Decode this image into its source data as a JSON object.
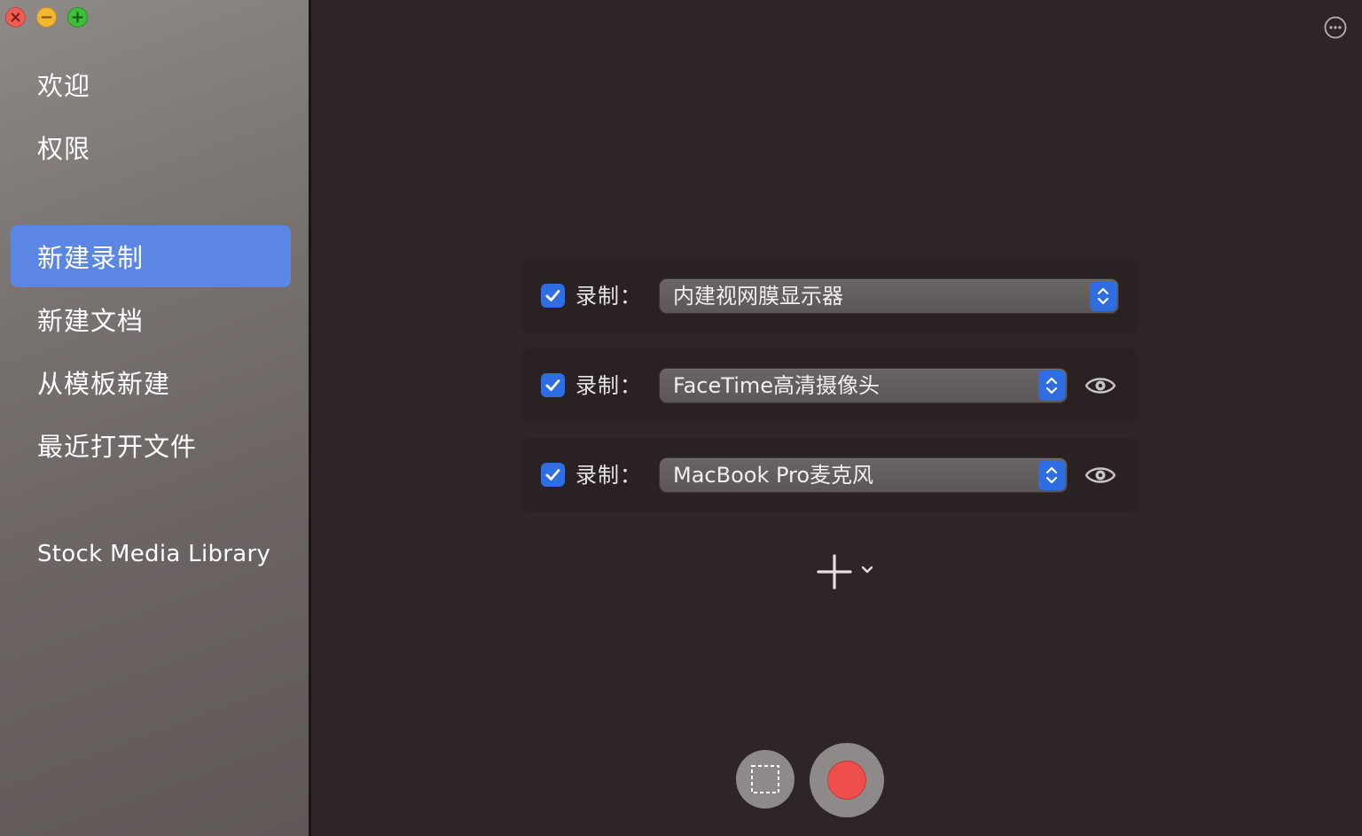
{
  "sidebar": {
    "items": [
      {
        "label": "欢迎",
        "selected": false
      },
      {
        "label": "权限",
        "selected": false
      },
      {
        "label": "新建录制",
        "selected": true
      },
      {
        "label": "新建文档",
        "selected": false
      },
      {
        "label": "从模板新建",
        "selected": false
      },
      {
        "label": "最近打开文件",
        "selected": false
      },
      {
        "label": "Stock Media Library",
        "selected": false
      }
    ]
  },
  "sources": [
    {
      "label": "录制：",
      "checked": true,
      "value": "内建视网膜显示器",
      "has_preview": false
    },
    {
      "label": "录制：",
      "checked": true,
      "value": "FaceTime高清摄像头",
      "has_preview": true
    },
    {
      "label": "录制：",
      "checked": true,
      "value": "MacBook Pro麦克风",
      "has_preview": true
    }
  ],
  "colors": {
    "accent": "#2f6ee2",
    "selection": "#5b86e4",
    "record": "#ee4f4a",
    "background": "#2e2626"
  },
  "icons": {
    "more": "ellipsis-circle-icon",
    "add": "plus-icon",
    "region": "dashed-selection-icon",
    "preview": "eye-icon"
  }
}
